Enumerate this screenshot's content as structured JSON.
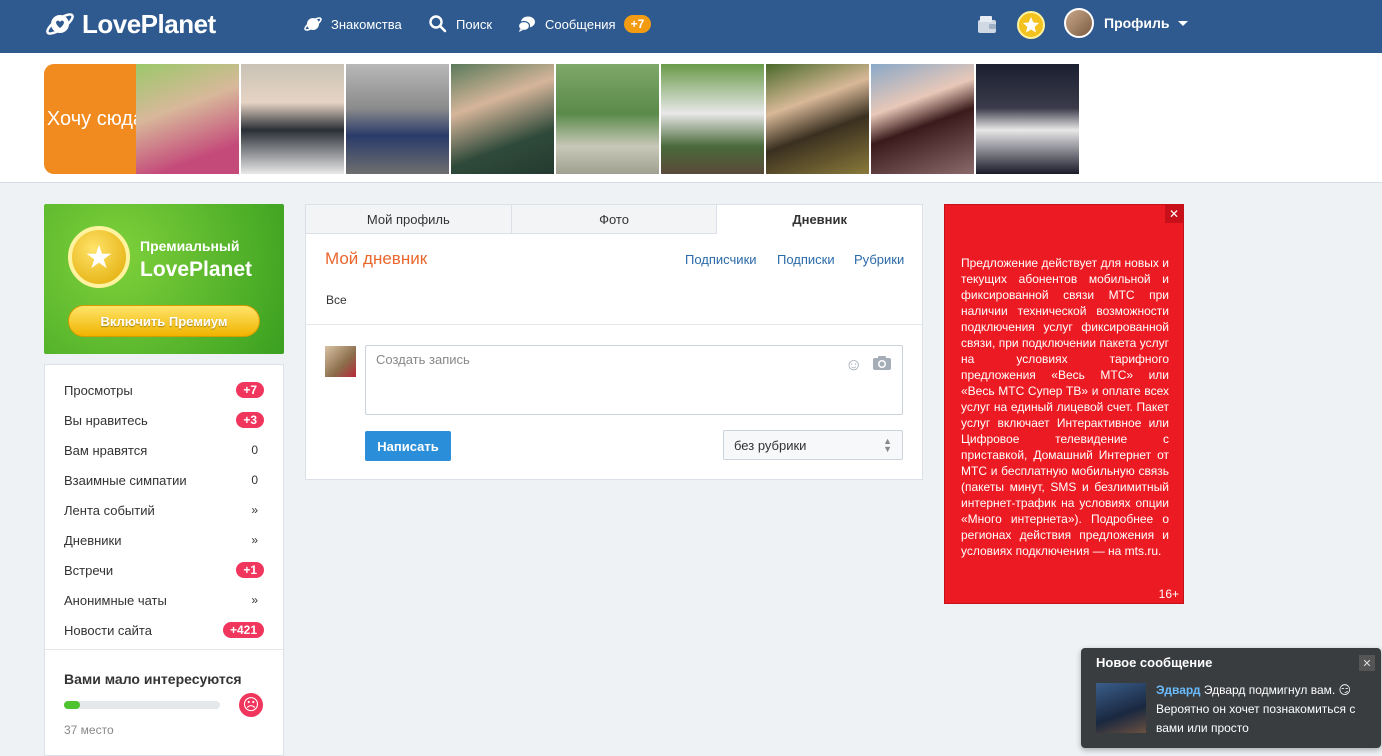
{
  "header": {
    "logo": "LovePlanet",
    "nav": [
      {
        "label": "Знакомства",
        "icon": "planet-icon"
      },
      {
        "label": "Поиск",
        "icon": "search-icon"
      },
      {
        "label": "Сообщения",
        "icon": "chat-icon",
        "badge": "+7"
      }
    ],
    "profile_label": "Профиль"
  },
  "strip": {
    "want_here": "Хочу сюда"
  },
  "premium": {
    "line1": "Премиальный",
    "line2": "LovePlanet",
    "button": "Включить Премиум"
  },
  "stats": [
    {
      "label": "Просмотры",
      "value": "+7",
      "badge": true
    },
    {
      "label": "Вы нравитесь",
      "value": "+3",
      "badge": true
    },
    {
      "label": "Вам нравятся",
      "value": "0",
      "badge": false
    },
    {
      "label": "Взаимные симпатии",
      "value": "0",
      "badge": false
    },
    {
      "label": "Лента событий",
      "value": "»",
      "badge": false
    },
    {
      "label": "Дневники",
      "value": "»",
      "badge": false
    },
    {
      "label": "Встречи",
      "value": "+1",
      "badge": true
    },
    {
      "label": "Анонимные чаты",
      "value": "»",
      "badge": false
    },
    {
      "label": "Новости сайта",
      "value": "+421",
      "badge": true
    }
  ],
  "interest": {
    "title": "Вами мало интересуются",
    "place": "37 место",
    "progress": 0.1
  },
  "diary": {
    "tabs": [
      "Мой профиль",
      "Фото",
      "Дневник"
    ],
    "active_tab": 2,
    "title": "Мой дневник",
    "links": [
      "Подписчики",
      "Подписки",
      "Рубрики"
    ],
    "filter": "Все",
    "placeholder": "Создать запись",
    "submit": "Написать",
    "rubric": "без рубрики"
  },
  "ad": {
    "text": "Предложение действует для новых и текущих абонентов мобильной и фиксированной связи МТС при наличии технической возможности подключения услуг фиксированной связи, при подключении пакета услуг на условиях тарифного предложения «Весь МТС» или «Весь МТС Супер ТВ» и оплате всех услуг на единый лицевой счет. Пакет услуг включает Интерактивное или Цифровое телевидение с приставкой, Домашний Интернет от МТС и бесплатную мобильную связь (пакеты минут, SMS и безлимитный интернет-трафик на условиях опции «Много интернета»). Подробнее о регионах действия предложения и условиях подключения — на mts.ru.",
    "age": "16+"
  },
  "notification": {
    "title": "Новое сообщение",
    "name": "Эдвард",
    "text": "Эдвард подмигнул вам. 😏 Вероятно он хочет познакомиться с вами или просто"
  }
}
